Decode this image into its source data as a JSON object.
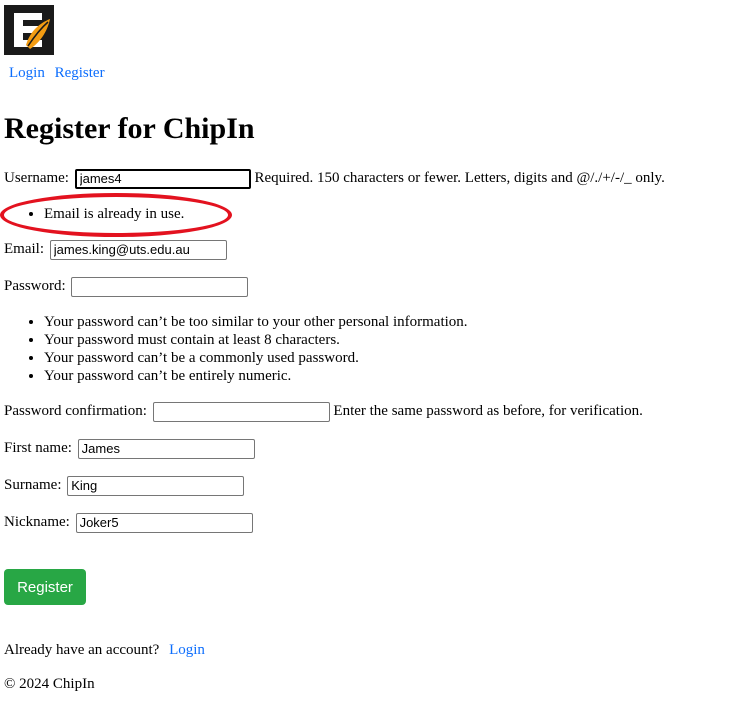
{
  "nav": {
    "login": "Login",
    "register": "Register"
  },
  "page_title": "Register for ChipIn",
  "username": {
    "label": "Username:",
    "value": "james4",
    "help": "Required. 150 characters or fewer. Letters, digits and @/./+/-/_ only."
  },
  "errors": [
    "Email is already in use."
  ],
  "email": {
    "label": "Email:",
    "value": "james.king@uts.edu.au"
  },
  "password": {
    "label": "Password:",
    "value": "",
    "rules": [
      "Your password can’t be too similar to your other personal information.",
      "Your password must contain at least 8 characters.",
      "Your password can’t be a commonly used password.",
      "Your password can’t be entirely numeric."
    ]
  },
  "password_confirmation": {
    "label": "Password confirmation:",
    "value": "",
    "help": "Enter the same password as before, for verification."
  },
  "first_name": {
    "label": "First name:",
    "value": "James"
  },
  "surname": {
    "label": "Surname:",
    "value": "King"
  },
  "nickname": {
    "label": "Nickname:",
    "value": "Joker5"
  },
  "submit_label": "Register",
  "footer": {
    "prompt": "Already have an account?",
    "login_link": "Login",
    "copyright": "© 2024 ChipIn"
  },
  "colors": {
    "link": "#0d6efd",
    "button": "#28a745",
    "annotation_circle": "#e3121f"
  }
}
